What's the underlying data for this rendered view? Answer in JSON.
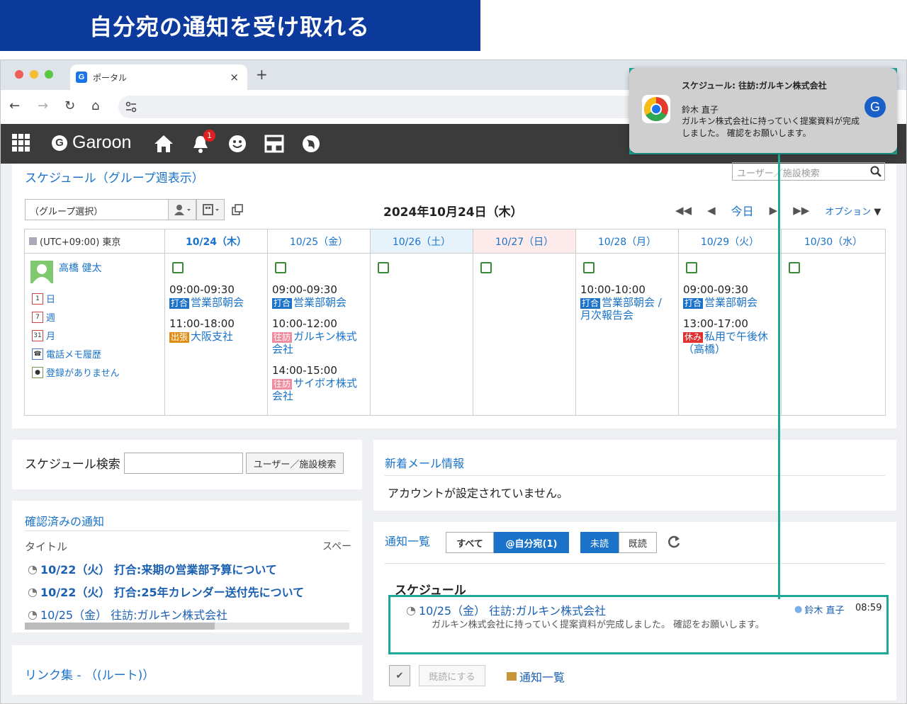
{
  "banner": {
    "title": "自分宛の通知を受け取れる"
  },
  "browser": {
    "tab_title": "ポータル",
    "tab_icon": "G",
    "close": "×",
    "new_tab": "+"
  },
  "toolbar": {
    "back": "←",
    "forward": "→",
    "reload": "↻",
    "home": "⌂"
  },
  "header": {
    "logo": "Garoon",
    "logo_mark": "G",
    "notif_count": "1"
  },
  "schedule": {
    "title": "スケジュール（グループ週表示）",
    "user_search_placeholder": "ユーザー／施設検索",
    "group_select": "（グループ選択）",
    "date": "2024年10月24日（木）",
    "today": "今日",
    "option": "オプション",
    "timezone": "(UTC+09:00) 東京",
    "columns": [
      "10/24（木）",
      "10/25（金）",
      "10/26（土）",
      "10/27（日）",
      "10/28（月）",
      "10/29（火）",
      "10/30（水）"
    ],
    "user": {
      "name": "高橋 健太",
      "links": [
        "日",
        "週",
        "月",
        "電話メモ履歴",
        "登録がありません"
      ]
    },
    "events": {
      "d24": [
        {
          "time": "09:00-09:30",
          "tag": "打合",
          "title": "営業部朝会"
        },
        {
          "time": "11:00-18:00",
          "tag": "出張",
          "title": "大阪支社"
        }
      ],
      "d25": [
        {
          "time": "09:00-09:30",
          "tag": "打合",
          "title": "営業部朝会"
        },
        {
          "time": "10:00-12:00",
          "tag": "往訪",
          "title": "ガルキン株式会社"
        },
        {
          "time": "14:00-15:00",
          "tag": "往訪",
          "title": "サイボオ株式会社"
        }
      ],
      "d28": [
        {
          "time": "10:00-10:00",
          "tag": "打合",
          "title": "営業部朝会 / 月次報告会"
        }
      ],
      "d29": [
        {
          "time": "09:00-09:30",
          "tag": "打合",
          "title": "営業部朝会"
        },
        {
          "time": "13:00-17:00",
          "tag": "休み",
          "title": "私用で午後休（高橋）"
        }
      ]
    }
  },
  "schedule_search": {
    "label": "スケジュール検索",
    "button": "ユーザー／施設検索"
  },
  "confirmed": {
    "title": "確認済みの通知",
    "col_title": "タイトル",
    "col_space": "スペー",
    "items": [
      "10/22（火） 打合:来期の営業部予算について",
      "10/22（火） 打合:25年カレンダー送付先について",
      "10/25（金） 往訪:ガルキン株式会社"
    ]
  },
  "links": {
    "title": "リンク集 - （(ルート)）"
  },
  "mail": {
    "title": "新着メール情報",
    "message": "アカウントが設定されていません。"
  },
  "notifications": {
    "title": "通知一覧",
    "filter_all": "すべて",
    "filter_mine": "@自分宛(1)",
    "unread": "未読",
    "read": "既読",
    "section": "スケジュール",
    "item_title": "10/25（金） 往訪:ガルキン株式会社",
    "item_user": "鈴木 直子",
    "item_time": "08:59",
    "item_body": "ガルキン株式会社に持っていく提案資料が完成しました。 確認をお願いします。",
    "mark_read": "既読にする",
    "list_link": "通知一覧"
  },
  "toast": {
    "title": "スケジュール: 往訪:ガルキン株式会社",
    "sender": "鈴木 直子",
    "body": "ガルキン株式会社に持っていく提案資料が完成しました。 確認をお願いします。",
    "avatar": "G"
  },
  "colors": {
    "accent": "#1a73c8",
    "highlight": "#1ea898",
    "banner": "#0c3a9c"
  }
}
